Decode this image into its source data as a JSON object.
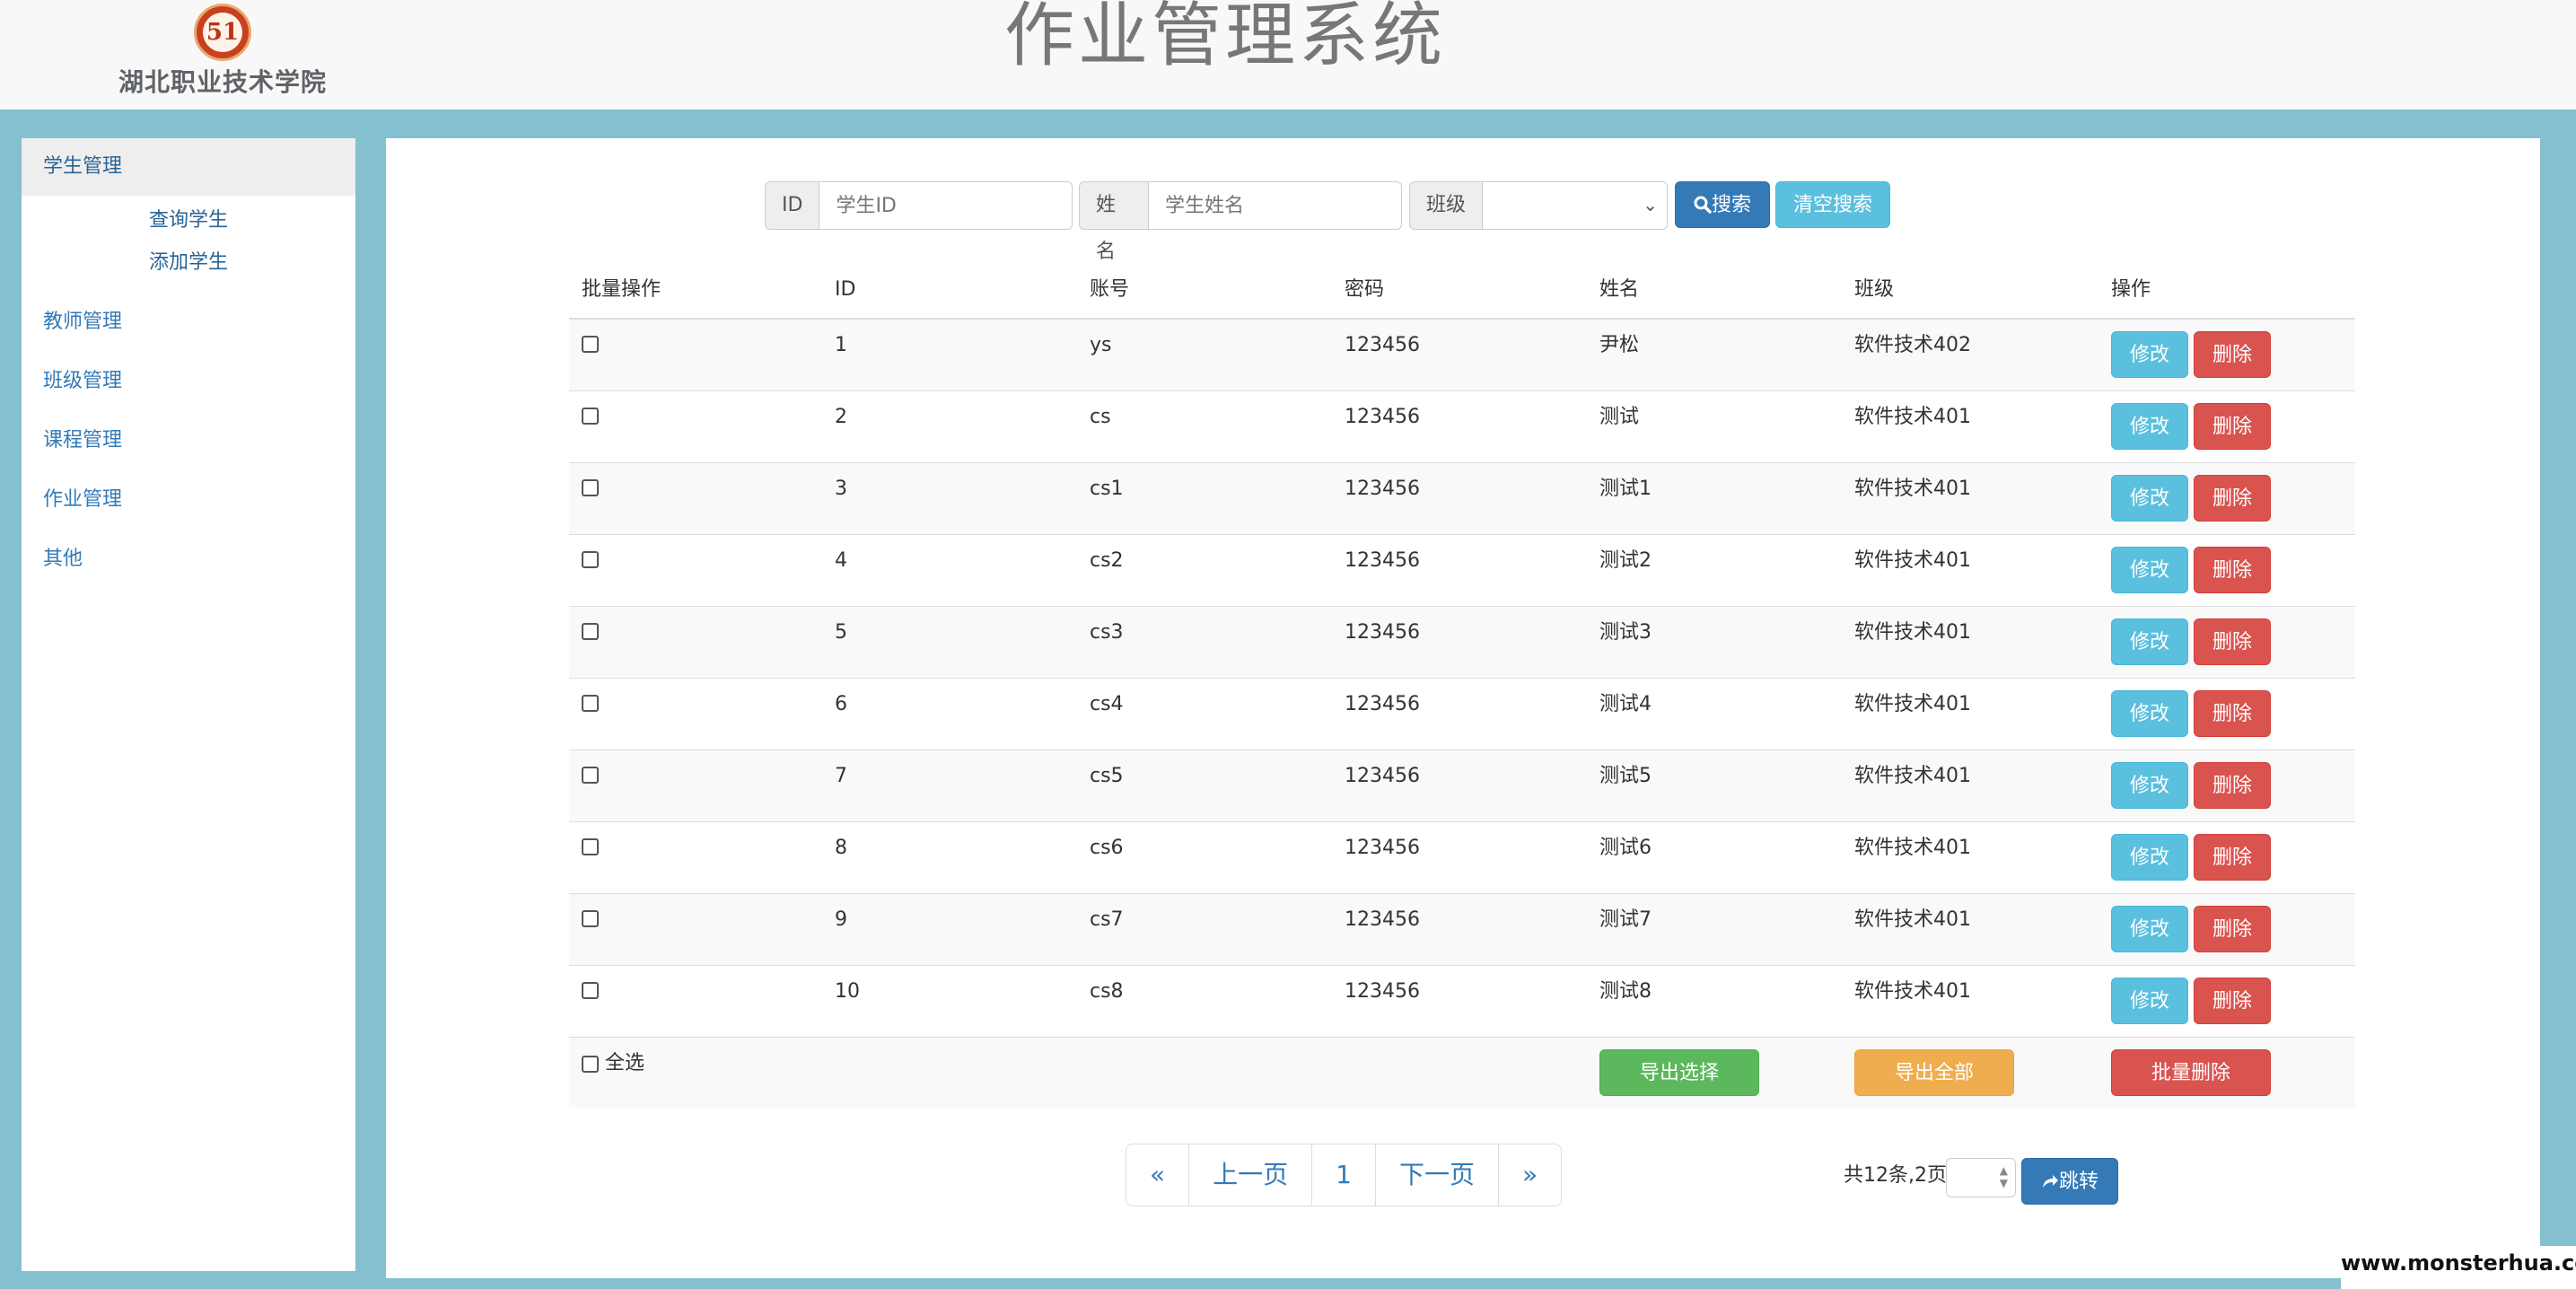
{
  "header": {
    "school_name": "湖北职业技术学院",
    "system_title": "作业管理系统",
    "logo_glyph": "51"
  },
  "sidebar": {
    "groups": [
      {
        "label": "学生管理",
        "expanded": true,
        "items": [
          "查询学生",
          "添加学生"
        ]
      },
      {
        "label": "教师管理"
      },
      {
        "label": "班级管理"
      },
      {
        "label": "课程管理"
      },
      {
        "label": "作业管理"
      },
      {
        "label": "其他"
      }
    ]
  },
  "search": {
    "id_label": "ID",
    "id_placeholder": "学生ID",
    "name_label": "姓名",
    "name_placeholder": "学生姓名",
    "class_label": "班级",
    "class_value": "",
    "search_button": "搜索",
    "clear_button": "清空搜索"
  },
  "table": {
    "headers": [
      "批量操作",
      "ID",
      "账号",
      "密码",
      "姓名",
      "班级",
      "操作"
    ],
    "rows": [
      {
        "id": "1",
        "account": "ys",
        "password": "123456",
        "name": "尹松",
        "class": "软件技术402"
      },
      {
        "id": "2",
        "account": "cs",
        "password": "123456",
        "name": "测试",
        "class": "软件技术401"
      },
      {
        "id": "3",
        "account": "cs1",
        "password": "123456",
        "name": "测试1",
        "class": "软件技术401"
      },
      {
        "id": "4",
        "account": "cs2",
        "password": "123456",
        "name": "测试2",
        "class": "软件技术401"
      },
      {
        "id": "5",
        "account": "cs3",
        "password": "123456",
        "name": "测试3",
        "class": "软件技术401"
      },
      {
        "id": "6",
        "account": "cs4",
        "password": "123456",
        "name": "测试4",
        "class": "软件技术401"
      },
      {
        "id": "7",
        "account": "cs5",
        "password": "123456",
        "name": "测试5",
        "class": "软件技术401"
      },
      {
        "id": "8",
        "account": "cs6",
        "password": "123456",
        "name": "测试6",
        "class": "软件技术401"
      },
      {
        "id": "9",
        "account": "cs7",
        "password": "123456",
        "name": "测试7",
        "class": "软件技术401"
      },
      {
        "id": "10",
        "account": "cs8",
        "password": "123456",
        "name": "测试8",
        "class": "软件技术401"
      }
    ],
    "edit_label": "修改",
    "delete_label": "删除",
    "select_all_label": "全选",
    "export_selected": "导出选择",
    "export_all": "导出全部",
    "batch_delete": "批量删除"
  },
  "pagination": {
    "first": "«",
    "prev": "上一页",
    "current": "1",
    "next": "下一页",
    "last": "»",
    "summary": "共12条,2页",
    "jump_button": "跳转"
  },
  "watermark": "www.monsterhua.com",
  "colors": {
    "page_bg": "#84c0d0",
    "primary": "#337ab7",
    "info": "#5bc0de",
    "danger": "#d9534f",
    "success": "#5cb85c",
    "warning": "#f0ad4e"
  }
}
